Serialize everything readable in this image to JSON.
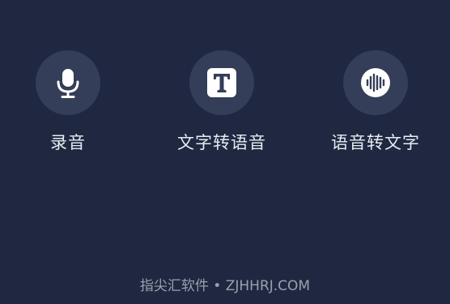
{
  "actions": [
    {
      "label": "录音",
      "icon": "microphone-icon"
    },
    {
      "label": "文字转语音",
      "icon": "text-t-icon"
    },
    {
      "label": "语音转文字",
      "icon": "sound-wave-icon"
    }
  ],
  "watermark": "指尖汇软件 • ZJHHRJ.COM",
  "colors": {
    "background": "#1f2840",
    "icon_circle": "#343e58",
    "label": "#e8ebf2",
    "watermark": "#9aa0ae"
  }
}
